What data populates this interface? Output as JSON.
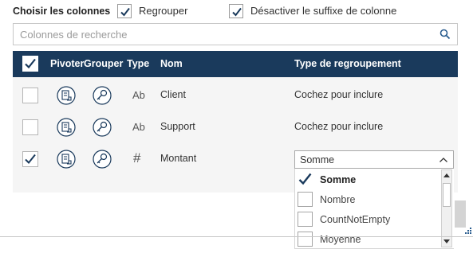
{
  "header": {
    "title": "Choisir les colonnes",
    "regroup": {
      "label": "Regrouper",
      "checked": true
    },
    "disable_suffix": {
      "label": "Désactiver le suffixe de colonne",
      "checked": true
    }
  },
  "search": {
    "placeholder": "Colonnes de recherche",
    "value": ""
  },
  "table": {
    "columns": [
      "Pivoter",
      "Grouper",
      "Type",
      "Nom",
      "Type de regroupement"
    ],
    "header_checkbox_checked": true,
    "rows": [
      {
        "checked": false,
        "type_icon": "Ab",
        "name": "Client",
        "grouping": "Cochez pour inclure"
      },
      {
        "checked": false,
        "type_icon": "Ab",
        "name": "Support",
        "grouping": "Cochez pour inclure"
      },
      {
        "checked": true,
        "type_icon": "#",
        "name": "Montant",
        "grouping": "Somme"
      }
    ]
  },
  "dropdown": {
    "selected": "Somme",
    "options": [
      {
        "label": "Somme",
        "checked": true
      },
      {
        "label": "Nombre",
        "checked": false
      },
      {
        "label": "CountNotEmpty",
        "checked": false
      },
      {
        "label": "Moyenne",
        "checked": false
      }
    ]
  },
  "colors": {
    "header_bg": "#1a3a5c",
    "accent": "#1a3a5c",
    "panel_bg": "#f5f5f5"
  }
}
